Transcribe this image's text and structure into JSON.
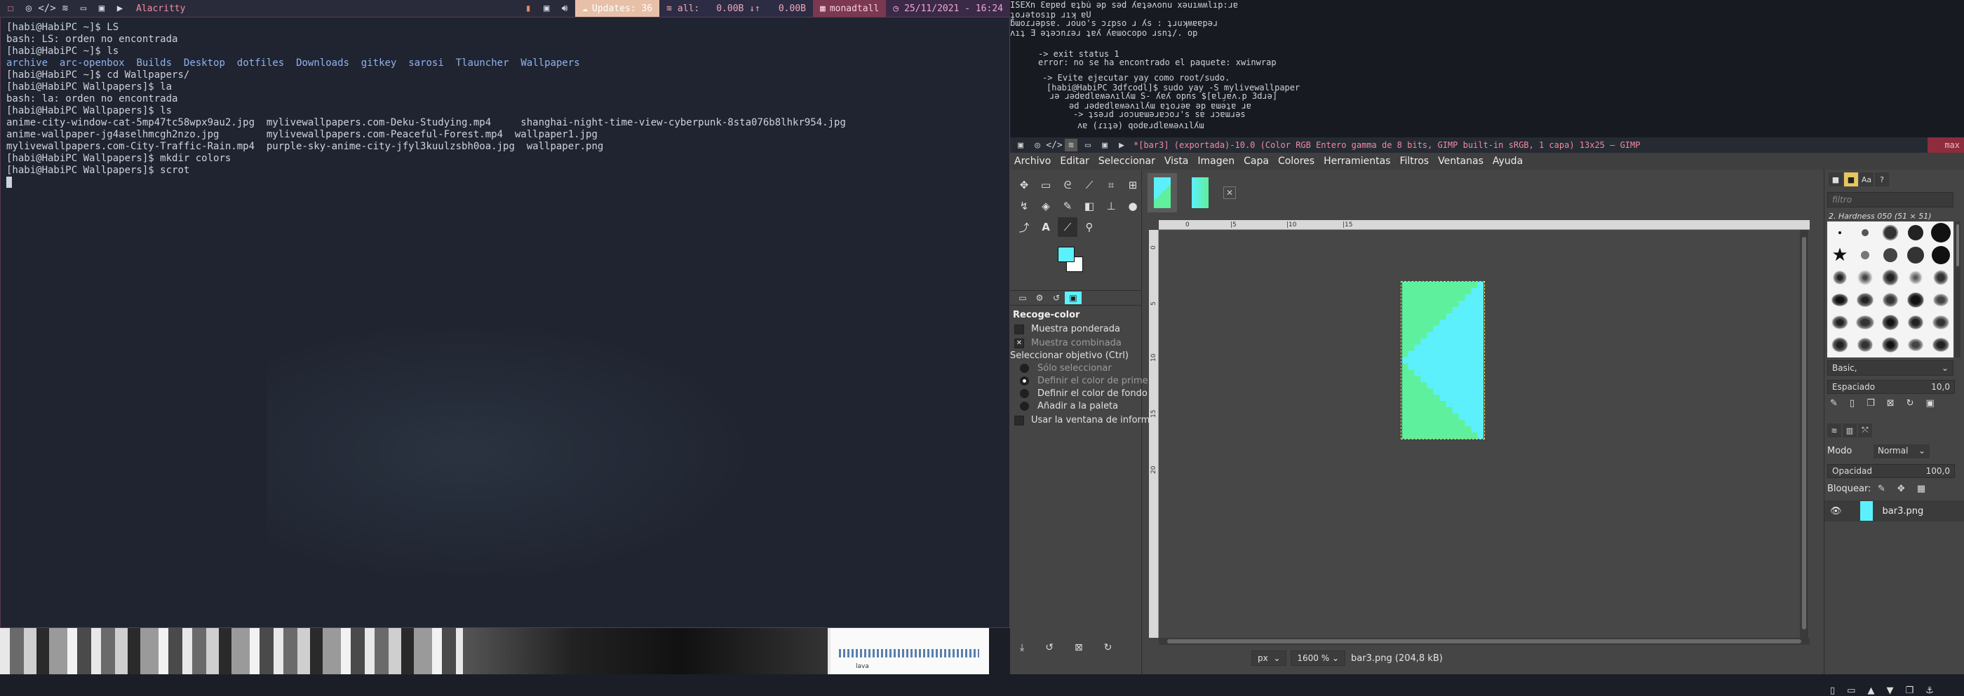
{
  "topbar": {
    "window_title": "Alacritty",
    "updates": "Updates: 36",
    "net_iface": "all:",
    "net_down": "0.00B ↓↑",
    "net_up": "0.00B",
    "layout": "monadtall",
    "datetime": "25/11/2021 - 16:24",
    "colors": {
      "bar_bg": "#2a2b3a",
      "accent_pink": "#f18ea6",
      "updates_bg": "#e8c0a8",
      "net_bg": "#2c2c44",
      "layout_bg": "#7b3850",
      "clock_bg": "#3a2a48"
    }
  },
  "terminal": {
    "lines": [
      {
        "prompt": "[habi@HabiPC ~]$ ",
        "cmd": "LS"
      },
      {
        "text": "bash: LS: orden no encontrada"
      },
      {
        "prompt": "[habi@HabiPC ~]$ ",
        "cmd": "ls"
      },
      {
        "dirs": [
          "archive",
          "arc-openbox",
          "Builds",
          "Desktop",
          "dotfiles",
          "Downloads",
          "gitkey",
          "sarosi",
          "Tlauncher",
          "Wallpapers"
        ]
      },
      {
        "prompt": "[habi@HabiPC ~]$ ",
        "cmd": "cd Wallpapers/"
      },
      {
        "prompt": "[habi@HabiPC Wallpapers]$ ",
        "cmd": "la"
      },
      {
        "text": "bash: la: orden no encontrada"
      },
      {
        "prompt": "[habi@HabiPC Wallpapers]$ ",
        "cmd": "ls"
      },
      {
        "text": "anime-city-window-cat-5mp47tc58wpx9au2.jpg  mylivewallpapers.com-Deku-Studying.mp4     shanghai-night-time-view-cyberpunk-8sta076b8lhkr954.jpg"
      },
      {
        "text": "anime-wallpaper-jg4aselhmcgh2nzo.jpg        mylivewallpapers.com-Peaceful-Forest.mp4  wallpaper1.jpg"
      },
      {
        "text": "mylivewallpapers.com-City-Traffic-Rain.mp4  purple-sky-anime-city-jfyl3kuulzsbh0oa.jpg  wallpaper.png"
      },
      {
        "prompt": "[habi@HabiPC Wallpapers]$ ",
        "cmd": "mkdir colors"
      },
      {
        "prompt": "[habi@HabiPC Wallpapers]$ ",
        "cmd": "scrot"
      }
    ]
  },
  "bgterm": {
    "lines": [
      "ISEXn Ɛɐpɐd ɐʇbu̇ ǝp sǝd ʎɐʇǝʌonu xǝuıʍʍlıp:ɹɐ",
      "ʇoɹǝtosıp ɹıʞ ɐU",
      "ƃɯoɾɹǝpsɐ. ɹouo's ɔɾpso ɹ ʎs : ʇɹuʞʍɐɐpǝɹ",
      "ʌıʇ Ǝ ǝʇǝɔnɾǝɹ ʇɐʎ ʎɐɯocopo ɹsnʇ/. op",
      "-> exit status 1",
      "error: no se ha encontrado el paquete: xwinwrap",
      "-> Evite ejecutar yay como root/sudo.",
      "[habi@HabiPC 3dfcodl]$ sudo yay -S mylivewallpaper",
      "ɹǝ ɹǝdɐdlɐʍǝʌılʎɯ S- ʎɐʎ opns $[ɐlɹ̗ɐʌ.p 3dɹǝ]",
      "ǝd ɹǝdɐdlɐʍǝʌılʎɯ ɐʇoɹǝɐ ǝp ɐɯǝʇɐ ɹɐ",
      "-> ʇsǝɹd ɹoɔuɐɯǝɹɐɔoɹ's sɐ ɹɔɐɯɹǝs",
      "ʌɐ (ɾıʇǝ) qodɐɹdlɐʍǝʌılʎɯ"
    ]
  },
  "strip": {
    "label": "lava"
  },
  "gimp": {
    "title": "*[bar3] (exportada)-10.0 (Color RGB Entero gamma de 8 bits, GIMP built-in sRGB, 1 capa) 13x25 – GIMP",
    "max_label": "max",
    "menu": [
      "Archivo",
      "Editar",
      "Seleccionar",
      "Vista",
      "Imagen",
      "Capa",
      "Colores",
      "Herramientas",
      "Filtros",
      "Ventanas",
      "Ayuda"
    ],
    "colors": {
      "fg": "#5cf0fc",
      "bg": "#ffffff",
      "image_green": "#5ef09c",
      "image_cyan": "#5cf0fc",
      "title_bg": "#262a33",
      "max_bg": "#8c2c3d"
    },
    "tool_options": {
      "title": "Recoge-color",
      "sample_average": "Muestra ponderada",
      "sample_merged": "Muestra combinada",
      "target_label": "Seleccionar objetivo  (Ctrl)",
      "radio": [
        "Sólo seleccionar",
        "Definir el color de prime",
        "Definir el color de fondo",
        "Añadir a la paleta"
      ],
      "use_info": "Usar la ventana de inform"
    },
    "ruler_h": [
      "0",
      "|5",
      "|10",
      "|15"
    ],
    "ruler_v": [
      "0",
      "5",
      "10",
      "15",
      "20"
    ],
    "status": {
      "unit": "px",
      "zoom": "1600 %",
      "file": "bar3.png (204,8 kB)"
    },
    "brushes": {
      "filter_placeholder": "filtro",
      "name": "2. Hardness 050 (51 × 51)",
      "preset": "Basic,",
      "spacing_label": "Espaciado",
      "spacing_value": "10,0"
    },
    "layers": {
      "mode_label": "Modo",
      "mode_value": "Normal",
      "opacity_label": "Opacidad",
      "opacity_value": "100,0",
      "lock_label": "Bloquear:",
      "layer_name": "bar3.png"
    }
  }
}
